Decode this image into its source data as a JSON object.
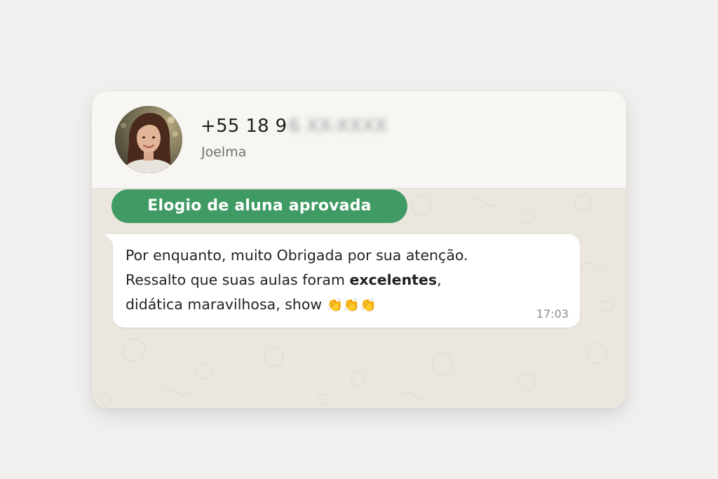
{
  "header": {
    "phone_visible": "+55 18 9",
    "phone_hidden": "6 XX-XXXX",
    "contact_name": "Joelma"
  },
  "tag": {
    "label": "Elogio de aluna aprovada"
  },
  "message": {
    "line1": "Por enquanto, muito Obrigada por sua atenção.",
    "line2_pre": "Ressalto que suas aulas foram ",
    "line2_bold": "excelentes",
    "line2_post": ",",
    "line3": "didática maravilhosa, show",
    "emojis": "👏👏👏",
    "time": "17:03"
  },
  "colors": {
    "accent_green": "#3f9a63",
    "chat_bg": "#ebe6de",
    "header_bg": "#f7f6f3"
  }
}
